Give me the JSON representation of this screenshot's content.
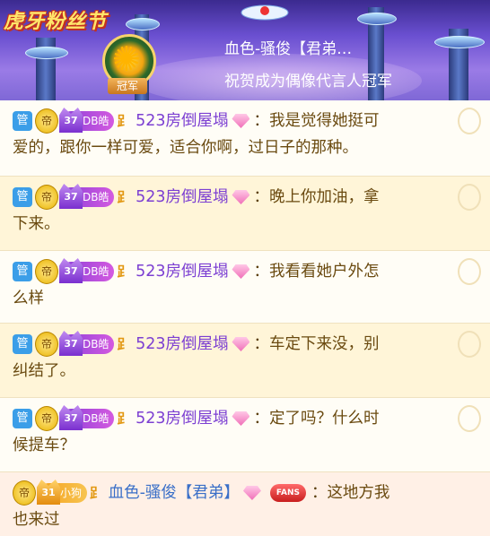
{
  "banner": {
    "festival_title": "虎牙粉丝节",
    "user_name": "血色-骚俊【君弟…",
    "subtitle": "祝贺成为偶像代言人冠军",
    "badge": "冠军"
  },
  "messages": [
    {
      "role_badge": "管",
      "medal": "帝",
      "level": "37",
      "fan_tag": "DB皓",
      "wing": "⻊",
      "user": "523房倒屋塌",
      "colon": "：",
      "line1": "我是觉得她挺可",
      "line2": "爱的，跟你一样可爱，适合你啊，过日子的那种。"
    },
    {
      "role_badge": "管",
      "medal": "帝",
      "level": "37",
      "fan_tag": "DB皓",
      "wing": "⻊",
      "user": "523房倒屋塌",
      "colon": "：",
      "line1": "晚上你加油，拿",
      "line2": "下来。"
    },
    {
      "role_badge": "管",
      "medal": "帝",
      "level": "37",
      "fan_tag": "DB皓",
      "wing": "⻊",
      "user": "523房倒屋塌",
      "colon": "：",
      "line1": "我看看她户外怎",
      "line2": "么样"
    },
    {
      "role_badge": "管",
      "medal": "帝",
      "level": "37",
      "fan_tag": "DB皓",
      "wing": "⻊",
      "user": "523房倒屋塌",
      "colon": "：",
      "line1": "车定下来没，别",
      "line2": "纠结了。"
    },
    {
      "role_badge": "管",
      "medal": "帝",
      "level": "37",
      "fan_tag": "DB皓",
      "wing": "⻊",
      "user": "523房倒屋塌",
      "colon": "：",
      "line1": "定了吗？什么时",
      "line2": "候提车？"
    }
  ],
  "last_message": {
    "medal": "帝",
    "level": "31",
    "fan_tag": "小狗",
    "wing": "⻊",
    "user": "血色-骚俊【君弟】",
    "ring": "FANS",
    "colon": "：",
    "line1": "这地方我",
    "line2": "也来过"
  },
  "colors": {
    "username_purple": "#7c3fd2",
    "username_blue": "#3a6fc8",
    "text": "#6a4a10"
  }
}
